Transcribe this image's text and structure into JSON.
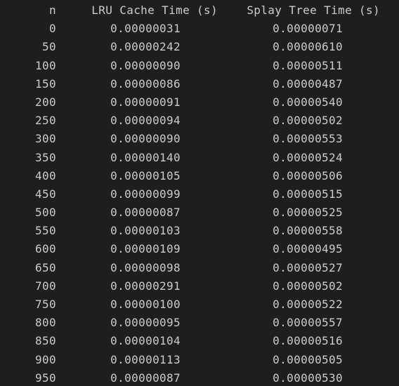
{
  "table": {
    "headers": [
      "n",
      "LRU Cache Time (s)",
      "Splay Tree Time (s)"
    ],
    "rows": [
      [
        "0",
        "0.00000031",
        "0.00000071"
      ],
      [
        "50",
        "0.00000242",
        "0.00000610"
      ],
      [
        "100",
        "0.00000090",
        "0.00000511"
      ],
      [
        "150",
        "0.00000086",
        "0.00000487"
      ],
      [
        "200",
        "0.00000091",
        "0.00000540"
      ],
      [
        "250",
        "0.00000094",
        "0.00000502"
      ],
      [
        "300",
        "0.00000090",
        "0.00000553"
      ],
      [
        "350",
        "0.00000140",
        "0.00000524"
      ],
      [
        "400",
        "0.00000105",
        "0.00000506"
      ],
      [
        "450",
        "0.00000099",
        "0.00000515"
      ],
      [
        "500",
        "0.00000087",
        "0.00000525"
      ],
      [
        "550",
        "0.00000103",
        "0.00000558"
      ],
      [
        "600",
        "0.00000109",
        "0.00000495"
      ],
      [
        "650",
        "0.00000098",
        "0.00000527"
      ],
      [
        "700",
        "0.00000291",
        "0.00000502"
      ],
      [
        "750",
        "0.00000100",
        "0.00000522"
      ],
      [
        "800",
        "0.00000095",
        "0.00000557"
      ],
      [
        "850",
        "0.00000104",
        "0.00000516"
      ],
      [
        "900",
        "0.00000113",
        "0.00000505"
      ],
      [
        "950",
        "0.00000087",
        "0.00000530"
      ]
    ]
  },
  "colors": {
    "background": "#1e1e1e",
    "text": "#cccccc"
  }
}
